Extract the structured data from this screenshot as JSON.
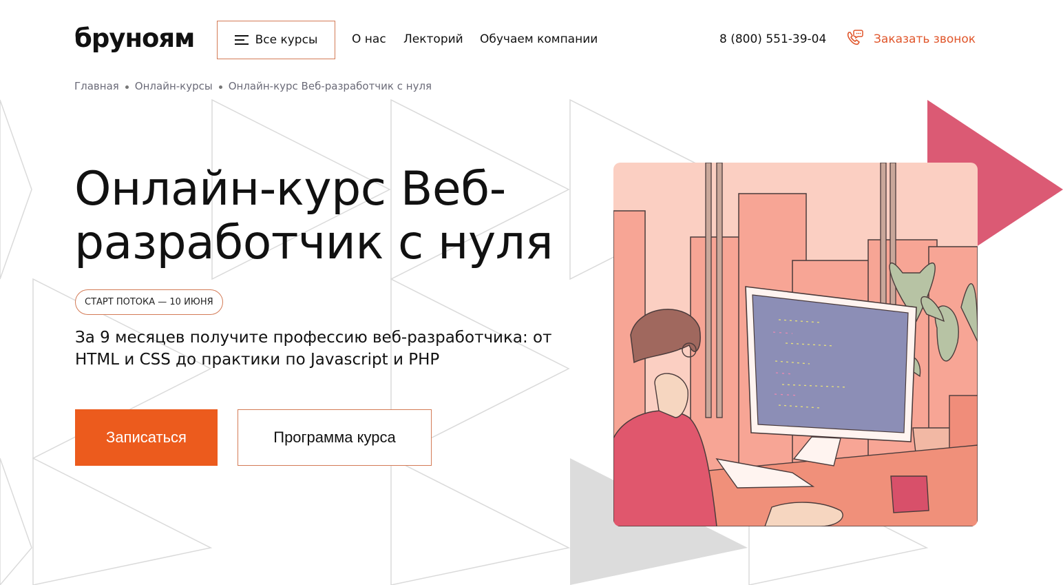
{
  "header": {
    "logo": "бруноям",
    "all_courses_label": "Все курсы",
    "nav": [
      {
        "label": "О нас"
      },
      {
        "label": "Лекторий"
      },
      {
        "label": "Обучаем компании"
      }
    ],
    "phone": "8 (800) 551-39-04",
    "call_label": "Заказать звонок"
  },
  "breadcrumb": [
    {
      "label": "Главная"
    },
    {
      "label": "Онлайн-курсы"
    },
    {
      "label": "Онлайн-курс Веб-разработчик с нуля"
    }
  ],
  "hero": {
    "title": "Онлайн-курс Веб-разработчик с нуля",
    "badge": "СТАРТ ПОТОКА — 10 ИЮНЯ",
    "subtitle": "За 9 месяцев получите профессию веб-разработчика: от HTML и CSS до практики по Javascript и PHP",
    "primary_button": "Записаться",
    "secondary_button": "Программа курса"
  },
  "colors": {
    "accent": "#ec5b1d",
    "border_accent": "#d37a55",
    "decor_pink": "#db5a74",
    "decor_gray": "#dcdcdc"
  },
  "icons": {
    "menu": "hamburger-icon",
    "call": "phone-chat-icon"
  }
}
